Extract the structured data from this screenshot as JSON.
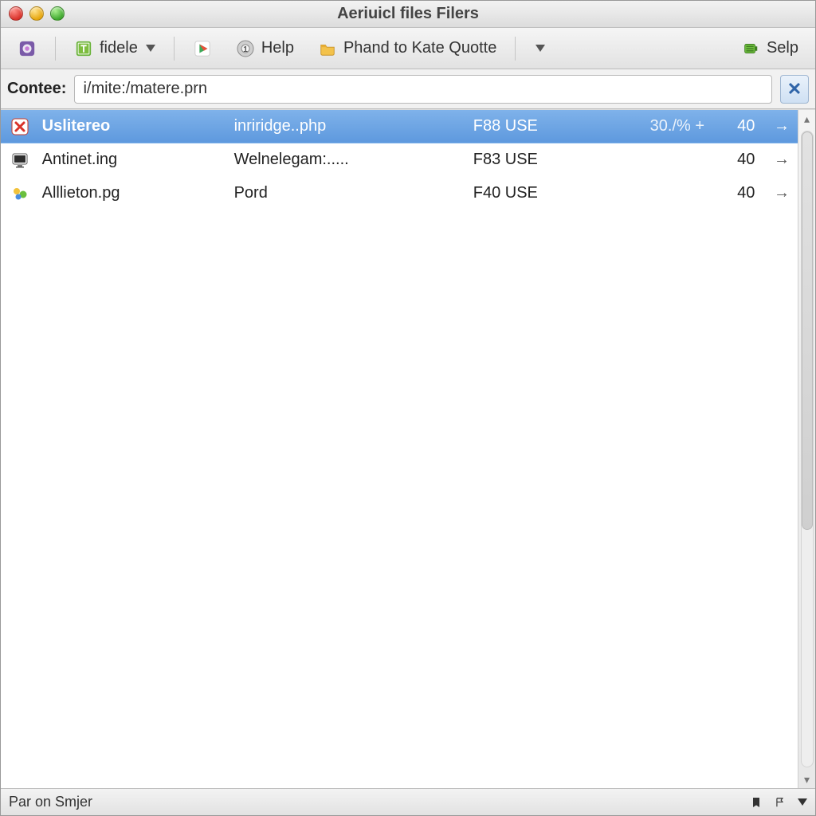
{
  "window": {
    "title": "Aeriuicl files Filers"
  },
  "toolbar": {
    "fidele_label": "fidele",
    "help_label": "Help",
    "phand_label": "Phand to Kate Quotte",
    "selp_label": "Selp"
  },
  "location": {
    "label": "Contee:",
    "value": "i/mite:/matere.prn"
  },
  "rows": [
    {
      "icon": "x-red",
      "name": "Uslitereo",
      "desc": "inriridge..php",
      "code": "F88 USE",
      "extra": "30./% +",
      "val": "40",
      "selected": true
    },
    {
      "icon": "monitor",
      "name": "Antinet.ing",
      "desc": "Welnelegam:.....",
      "code": "F83 USE",
      "extra": "",
      "val": "40",
      "selected": false
    },
    {
      "icon": "people",
      "name": "Alllieton.pg",
      "desc": "Pord",
      "code": "F40 USE",
      "extra": "",
      "val": "40",
      "selected": false
    }
  ],
  "status": {
    "text": "Par on Smjer"
  }
}
